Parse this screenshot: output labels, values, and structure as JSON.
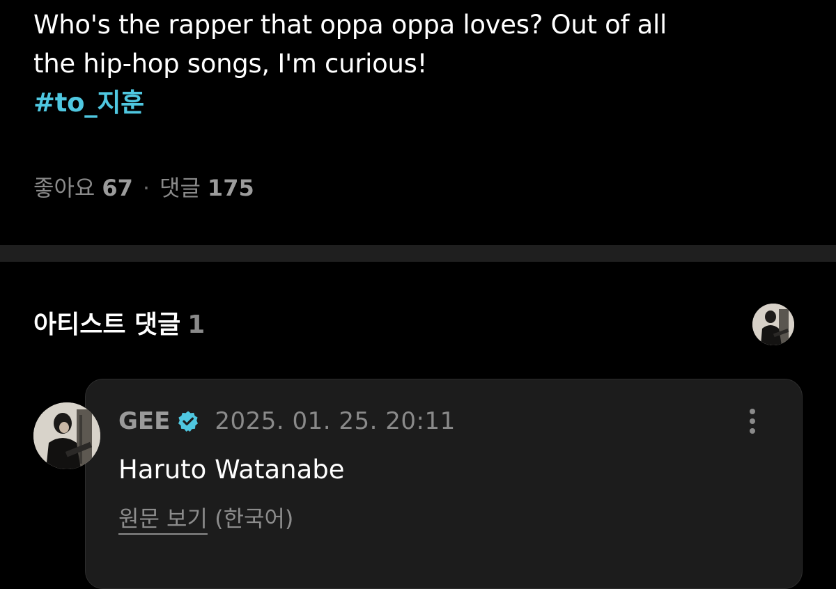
{
  "post": {
    "lines": [
      "Who's the rapper that oppa oppa loves? Out of all",
      "the hip-hop songs, I'm curious!"
    ],
    "hashtag": "#to_지훈",
    "likes_label": "좋아요",
    "likes_count": "67",
    "separator": "·",
    "comments_label": "댓글",
    "comments_count": "175"
  },
  "artist_comments": {
    "title": "아티스트 댓글",
    "count": "1"
  },
  "comment": {
    "author": "GEE",
    "timestamp": "2025. 01. 25. 20:11",
    "text": "Haruto Watanabe",
    "view_original_label": "원문 보기",
    "original_language": "(한국어)"
  },
  "colors": {
    "background": "#000000",
    "hashtag": "#4fc7e0",
    "verified_badge": "#4fc7e0",
    "card": "#1c1c1c",
    "divider": "#1f1f1f",
    "muted_text": "#8a8a8a"
  },
  "icons": {
    "verified": "verified-badge-icon",
    "more": "more-vertical-icon"
  }
}
